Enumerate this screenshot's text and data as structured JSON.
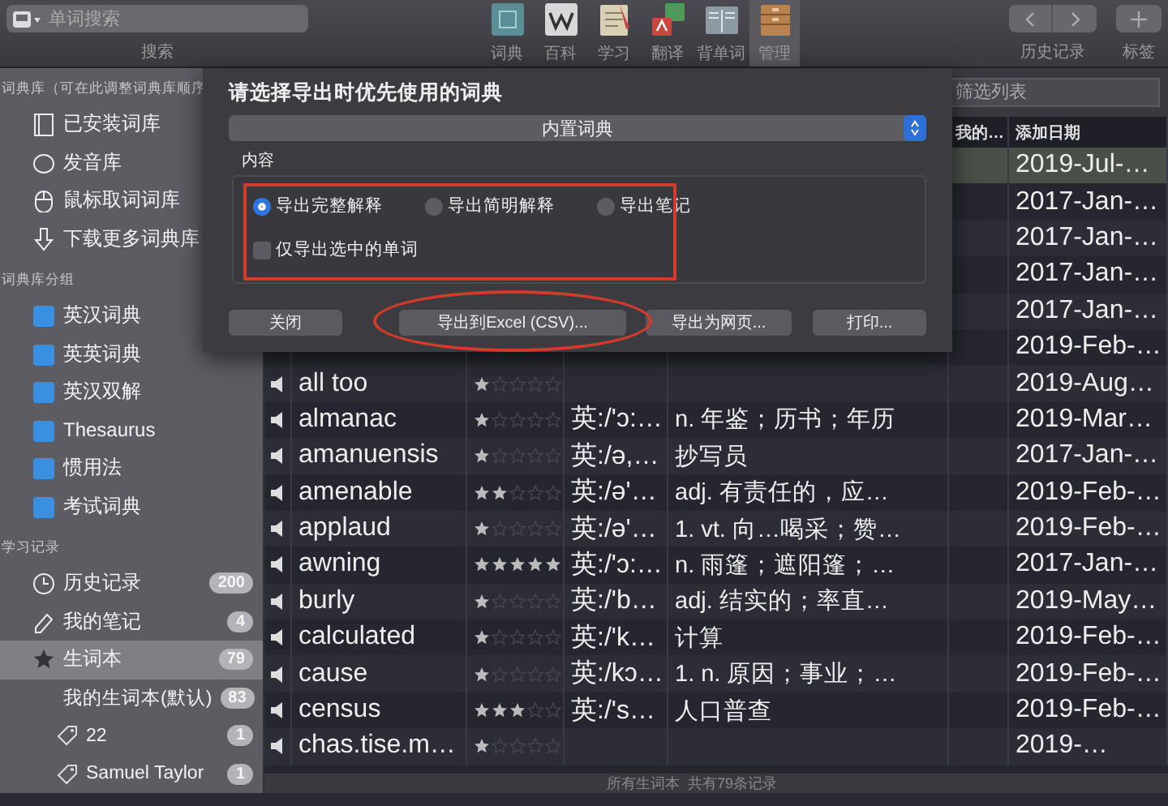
{
  "toolbar": {
    "search": {
      "placeholder": "单词搜索",
      "label": "搜索"
    },
    "tools": [
      {
        "label": "词典",
        "kind": "dictionary",
        "selected": false
      },
      {
        "label": "百科",
        "kind": "wiki",
        "selected": false
      },
      {
        "label": "学习",
        "kind": "study",
        "selected": false
      },
      {
        "label": "翻译",
        "kind": "translate",
        "selected": false
      },
      {
        "label": "背单词",
        "kind": "flashcard",
        "selected": false
      },
      {
        "label": "管理",
        "kind": "manage",
        "selected": true
      }
    ],
    "history_label": "历史记录",
    "tag_label": "标签"
  },
  "sidebar": {
    "sections": [
      {
        "title": "词典库（可在此调整词典库顺序",
        "items": [
          {
            "label": "已安装词库",
            "kind": "library",
            "selected": false
          },
          {
            "label": "发音库",
            "kind": "sound",
            "selected": false
          },
          {
            "label": "鼠标取词词库",
            "kind": "mouse",
            "selected": false
          },
          {
            "label": "下载更多词典库",
            "kind": "download",
            "selected": false
          }
        ]
      },
      {
        "title": "词典库分组",
        "items": [
          {
            "label": "英汉词典",
            "kind": "group",
            "selected": false
          },
          {
            "label": "英英词典",
            "kind": "group",
            "selected": false
          },
          {
            "label": "英汉双解",
            "kind": "group",
            "selected": false
          },
          {
            "label": "Thesaurus",
            "kind": "group",
            "selected": false
          },
          {
            "label": "惯用法",
            "kind": "group",
            "selected": false
          },
          {
            "label": "考试词典",
            "kind": "group",
            "selected": false
          }
        ]
      },
      {
        "title": "学习记录",
        "items": [
          {
            "label": "历史记录",
            "kind": "history",
            "count": "200",
            "selected": false
          },
          {
            "label": "我的笔记",
            "kind": "note",
            "count": "4",
            "selected": false
          },
          {
            "label": "生词本",
            "kind": "wordbook",
            "count": "79",
            "selected": true,
            "children": [
              {
                "label": "我的生词本(默认)",
                "kind": "tag",
                "count": "83",
                "selected": false
              },
              {
                "label": "22",
                "kind": "tag",
                "count": "1",
                "selected": false
              },
              {
                "label": "Samuel Taylor",
                "kind": "tag",
                "count": "1",
                "selected": false
              }
            ]
          }
        ]
      }
    ]
  },
  "table": {
    "filter_placeholder": "筛选列表",
    "headers": [
      "我的…",
      "添加日期"
    ],
    "rows": [
      {
        "date": "2019-Jul-…",
        "selected": true
      },
      {
        "date": "2017-Jan-…",
        "selected": false
      },
      {
        "date": "2017-Jan-…",
        "selected": false
      },
      {
        "date": "2017-Jan-…",
        "selected": false
      },
      {
        "date": "2017-Jan-…",
        "selected": false
      },
      {
        "date": "2019-Feb-…",
        "selected": false
      },
      {
        "word": "all too",
        "stars": 1,
        "date": "2019-Aug…",
        "selected": false
      },
      {
        "word": "almanac",
        "stars": 1,
        "phonetic": "英:/'ɔ:…",
        "meaning": "n. 年鉴；历书；年历",
        "date": "2019-Mar…",
        "selected": false
      },
      {
        "word": "amanuensis",
        "stars": 1,
        "phonetic": "英:/ə,…",
        "meaning": "抄写员",
        "date": "2017-Jan-…",
        "selected": false
      },
      {
        "word": "amenable",
        "stars": 2,
        "phonetic": "英:/ə'…",
        "meaning": "adj. 有责任的，应…",
        "date": "2019-Feb-…",
        "selected": false
      },
      {
        "word": "applaud",
        "stars": 1,
        "phonetic": "英:/ə'…",
        "meaning": "1. vt. 向…喝采；赞…",
        "date": "2019-Feb-…",
        "selected": false
      },
      {
        "word": "awning",
        "stars": 5,
        "phonetic": "英:/'ɔ:…",
        "meaning": "n. 雨篷；遮阳篷；…",
        "date": "2017-Jan-…",
        "selected": false
      },
      {
        "word": "burly",
        "stars": 1,
        "phonetic": "英:/'b…",
        "meaning": "adj. 结实的；率直…",
        "date": "2019-May…",
        "selected": false
      },
      {
        "word": "calculated",
        "stars": 1,
        "phonetic": "英:/'k…",
        "meaning": "计算",
        "date": "2019-Feb-…",
        "selected": false
      },
      {
        "word": "cause",
        "stars": 1,
        "phonetic": "英:/kɔ…",
        "meaning": "1. n. 原因；事业；…",
        "date": "2019-Feb-…",
        "selected": false
      },
      {
        "word": "census",
        "stars": 3,
        "phonetic": "英:/'s…",
        "meaning": "人口普查",
        "date": "2019-Feb-…",
        "selected": false
      },
      {
        "word": "chas.tise.m…",
        "stars": 1,
        "date": "2019-…",
        "selected": false
      }
    ],
    "status": "所有生词本  共有79条记录"
  },
  "dialog": {
    "title": "请选择导出时优先使用的词典",
    "dictionary": "内置词典",
    "content_label": "内容",
    "options": [
      {
        "label": "导出完整解释",
        "selected": true
      },
      {
        "label": "导出简明解释",
        "selected": false
      },
      {
        "label": "导出笔记",
        "selected": false
      }
    ],
    "only_selected": {
      "label": "仅导出选中的单词",
      "checked": false
    },
    "buttons": [
      {
        "label": "关闭"
      },
      {
        "label": "导出到Excel (CSV)..."
      },
      {
        "label": "导出为网页..."
      },
      {
        "label": "打印..."
      }
    ]
  }
}
